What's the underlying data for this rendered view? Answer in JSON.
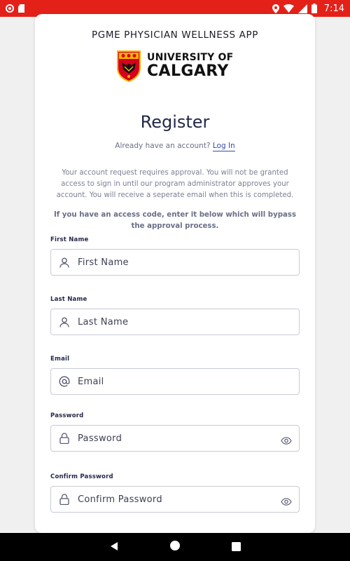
{
  "status_bar": {
    "time": "7:14",
    "color": "#e32119",
    "icons": [
      "record-icon",
      "sd-card-icon",
      "location-icon",
      "wifi-icon",
      "signal-icon",
      "battery-icon"
    ]
  },
  "app": {
    "title": "PGME PHYSICIAN WELLNESS APP",
    "logo_line1": "UNIVERSITY OF",
    "logo_line2": "CALGARY"
  },
  "register": {
    "title": "Register",
    "have_account_text": "Already have an account?",
    "login_link": "Log In",
    "notice": "Your account request requires approval. You will not be granted access to sign in until our program administrator approves your account. You will receive a seperate email when this is completed.",
    "access_code_notice": "If you have an access code, enter it below which will bypass the approval process."
  },
  "form": {
    "first_name": {
      "label": "First Name",
      "placeholder": "First Name",
      "icon": "person-icon"
    },
    "last_name": {
      "label": "Last Name",
      "placeholder": "Last Name",
      "icon": "person-icon"
    },
    "email": {
      "label": "Email",
      "placeholder": "Email",
      "icon": "at-icon"
    },
    "password": {
      "label": "Password",
      "placeholder": "Password",
      "icon": "lock-icon",
      "trailing_icon": "eye-icon"
    },
    "confirm_password": {
      "label": "Confirm Password",
      "placeholder": "Confirm Password",
      "icon": "lock-icon",
      "trailing_icon": "eye-icon"
    }
  },
  "nav_bar": {
    "icons": [
      "back-icon",
      "home-icon",
      "recents-icon"
    ]
  }
}
